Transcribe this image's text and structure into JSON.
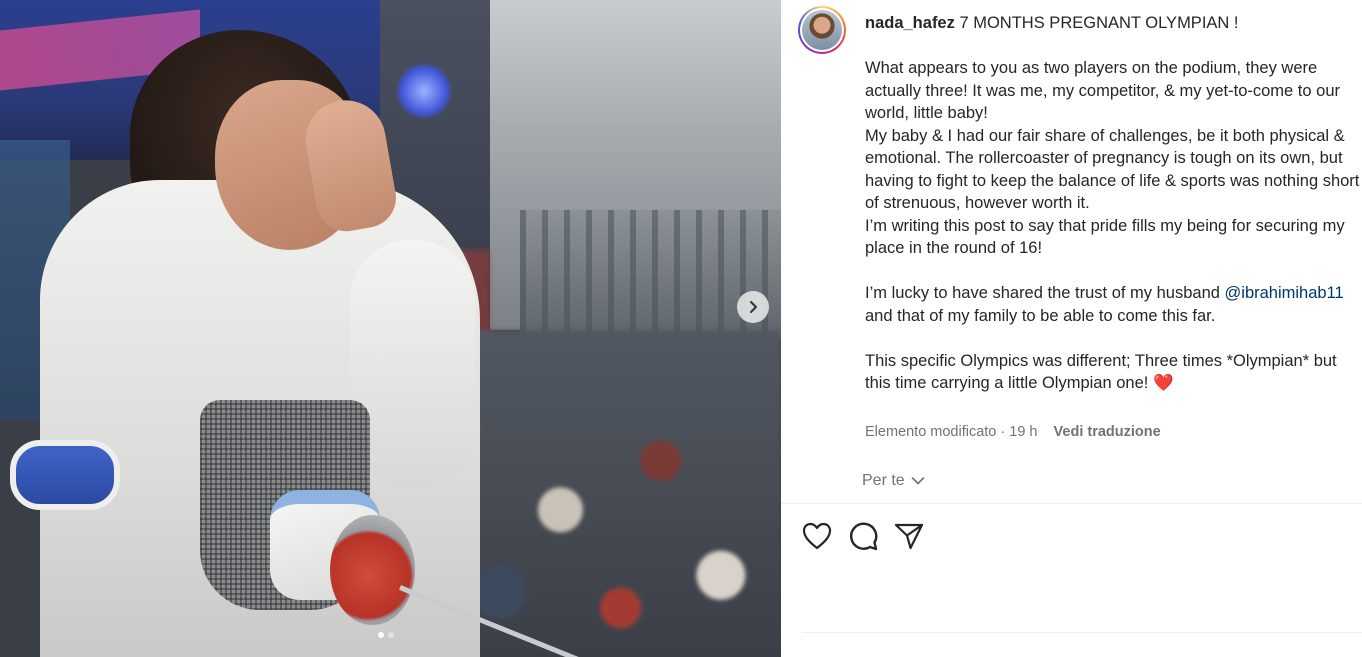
{
  "post": {
    "username": "nada_hafez",
    "title": "7 MONTHS PREGNANT OLYMPIAN !",
    "paragraph1": "What appears to you as two players on the podium, they were actually three! It was me, my competitor, & my yet-to-come to our world, little baby!",
    "paragraph2": "My baby & I had our fair share of challenges, be it both physical & emotional. The rollercoaster of pregnancy is tough on its own, but having to fight to keep the balance of life & sports was nothing short of strenuous, however worth it.",
    "paragraph3": "I’m writing this post to say that pride fills my being for securing my place in the round of 16!",
    "paragraph4_before": "I’m lucky to have shared the trust of my husband",
    "mention": "@ibrahimihab11",
    "paragraph4_after": "and that of my family to be able to come this far.",
    "paragraph5": "This specific Olympics was different; Three times *Olympian* but this time carrying a little Olympian one!",
    "emoji": "❤️",
    "edited_label": "Elemento modificato",
    "time_ago": "19 h",
    "translate_label": "Vedi traduzione",
    "for_you_label": "Per te"
  },
  "media": {
    "carousel_count": 2,
    "active_index": 0
  },
  "icons": {
    "next": "chevron-right-icon",
    "like": "heart-icon",
    "comment": "comment-icon",
    "share": "send-icon",
    "for_you": "chevron-down-icon"
  },
  "colors": {
    "text": "#262626",
    "secondary": "#737373",
    "mention": "#00376b",
    "emoji_heart": "#e0245e"
  }
}
